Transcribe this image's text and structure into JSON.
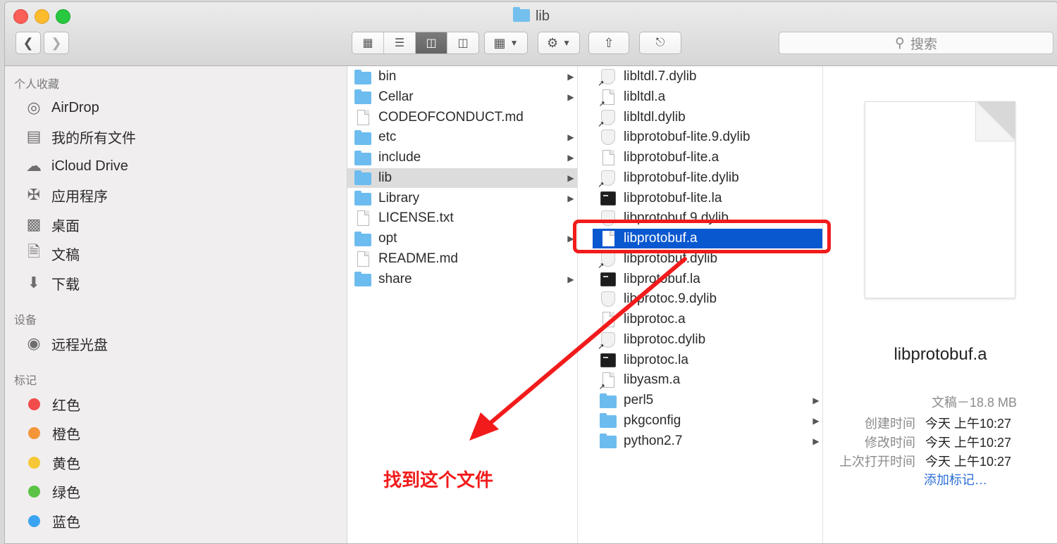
{
  "window": {
    "title": "lib"
  },
  "toolbar": {
    "back_icon": "chevron-left-icon",
    "forward_icon": "chevron-right-icon",
    "view_modes": [
      "icon-view-icon",
      "list-view-icon",
      "column-view-icon",
      "cover-flow-icon"
    ],
    "active_view": "column-view-icon",
    "search_placeholder": "搜索"
  },
  "sidebar": {
    "favorites_header": "个人收藏",
    "favorites": [
      {
        "label": "AirDrop",
        "icon": "airdrop-icon"
      },
      {
        "label": "我的所有文件",
        "icon": "all-files-icon"
      },
      {
        "label": "iCloud Drive",
        "icon": "cloud-icon"
      },
      {
        "label": "应用程序",
        "icon": "applications-icon"
      },
      {
        "label": "桌面",
        "icon": "desktop-icon"
      },
      {
        "label": "文稿",
        "icon": "documents-icon"
      },
      {
        "label": "下载",
        "icon": "downloads-icon"
      }
    ],
    "devices_header": "设备",
    "devices": [
      {
        "label": "远程光盘",
        "icon": "disc-icon"
      }
    ],
    "tags_header": "标记",
    "tags": [
      {
        "label": "红色",
        "color": "#f24b4b"
      },
      {
        "label": "橙色",
        "color": "#f5953a"
      },
      {
        "label": "黄色",
        "color": "#f6c736"
      },
      {
        "label": "绿色",
        "color": "#5ac345"
      },
      {
        "label": "蓝色",
        "color": "#3aa4f2"
      }
    ]
  },
  "column1": [
    {
      "name": "bin",
      "type": "folder",
      "chevron": true
    },
    {
      "name": "Cellar",
      "type": "folder",
      "chevron": true
    },
    {
      "name": "CODEOFCONDUCT.md",
      "type": "doc",
      "chevron": false
    },
    {
      "name": "etc",
      "type": "folder",
      "chevron": true
    },
    {
      "name": "include",
      "type": "folder",
      "chevron": true
    },
    {
      "name": "lib",
      "type": "folder",
      "chevron": true,
      "selected": "gray"
    },
    {
      "name": "Library",
      "type": "folder",
      "chevron": true
    },
    {
      "name": "LICENSE.txt",
      "type": "doc",
      "chevron": false
    },
    {
      "name": "opt",
      "type": "folder",
      "chevron": true
    },
    {
      "name": "README.md",
      "type": "doc",
      "chevron": false
    },
    {
      "name": "share",
      "type": "folder",
      "chevron": true
    }
  ],
  "column2": [
    {
      "name": "libltdl.7.dylib",
      "type": "shield-alias",
      "chevron": false
    },
    {
      "name": "libltdl.a",
      "type": "doc-alias",
      "chevron": false
    },
    {
      "name": "libltdl.dylib",
      "type": "shield-alias",
      "chevron": false
    },
    {
      "name": "libprotobuf-lite.9.dylib",
      "type": "shield",
      "chevron": false
    },
    {
      "name": "libprotobuf-lite.a",
      "type": "doc",
      "chevron": false
    },
    {
      "name": "libprotobuf-lite.dylib",
      "type": "shield-alias",
      "chevron": false
    },
    {
      "name": "libprotobuf-lite.la",
      "type": "term",
      "chevron": false
    },
    {
      "name": "libprotobuf.9.dylib",
      "type": "shield",
      "chevron": false
    },
    {
      "name": "libprotobuf.a",
      "type": "doc",
      "chevron": false,
      "selected": "blue"
    },
    {
      "name": "libprotobuf.dylib",
      "type": "shield-alias",
      "chevron": false
    },
    {
      "name": "libprotobuf.la",
      "type": "term",
      "chevron": false
    },
    {
      "name": "libprotoc.9.dylib",
      "type": "shield",
      "chevron": false
    },
    {
      "name": "libprotoc.a",
      "type": "doc",
      "chevron": false
    },
    {
      "name": "libprotoc.dylib",
      "type": "shield-alias",
      "chevron": false
    },
    {
      "name": "libprotoc.la",
      "type": "term",
      "chevron": false
    },
    {
      "name": "libyasm.a",
      "type": "doc-alias",
      "chevron": false
    },
    {
      "name": "perl5",
      "type": "folder",
      "chevron": true
    },
    {
      "name": "pkgconfig",
      "type": "folder",
      "chevron": true
    },
    {
      "name": "python2.7",
      "type": "folder",
      "chevron": true
    }
  ],
  "preview": {
    "filename": "libprotobuf.a",
    "kind": "文稿－18.8 MB",
    "meta": [
      {
        "label": "创建时间",
        "value": "今天 上午10:27"
      },
      {
        "label": "修改时间",
        "value": "今天 上午10:27"
      },
      {
        "label": "上次打开时间",
        "value": "今天 上午10:27"
      }
    ],
    "add_tags": "添加标记…"
  },
  "annotation": {
    "text": "找到这个文件",
    "color": "#f21b1b"
  }
}
